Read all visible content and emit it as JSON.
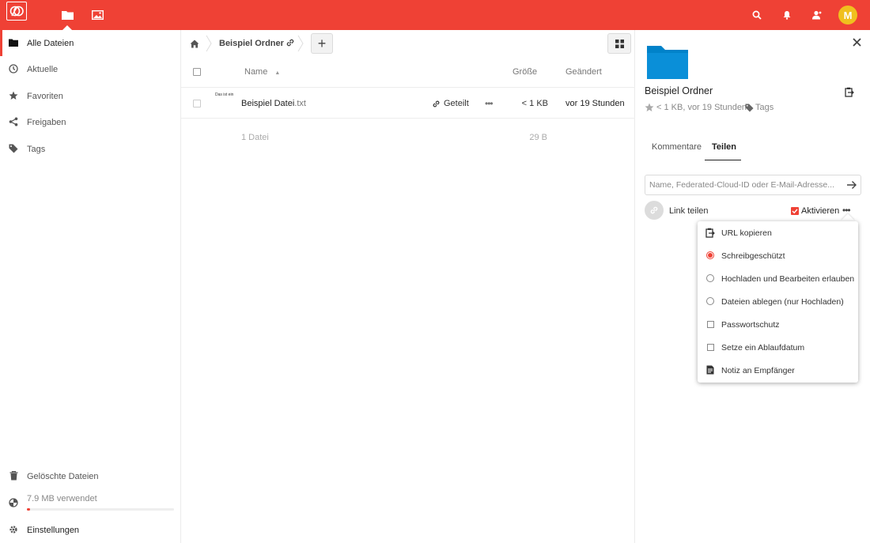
{
  "header": {
    "avatar_initial": "M",
    "brand_color": "#ef4135"
  },
  "sidebar": {
    "items": [
      {
        "label": "Alle Dateien",
        "icon": "folder-icon"
      },
      {
        "label": "Aktuelle",
        "icon": "clock-icon"
      },
      {
        "label": "Favoriten",
        "icon": "star-icon"
      },
      {
        "label": "Freigaben",
        "icon": "share-icon"
      },
      {
        "label": "Tags",
        "icon": "tag-icon"
      }
    ],
    "deleted_files": "Gelöschte Dateien",
    "quota_text": "7.9 MB verwendet",
    "quota_used_percent": 2,
    "settings": "Einstellungen"
  },
  "breadcrumb": {
    "folder": "Beispiel Ordner",
    "add_label": "+"
  },
  "file_table": {
    "columns": {
      "name": "Name",
      "size": "Größe",
      "modified": "Geändert"
    },
    "rows": [
      {
        "thumb_text": "Das ist ein",
        "name": "Beispiel Datei",
        "ext": ".txt",
        "shared_label": "Geteilt",
        "more": "•••",
        "size": "< 1 KB",
        "modified": "vor 19 Stunden"
      }
    ],
    "summary_count": "1 Datei",
    "summary_size": "29 B"
  },
  "details": {
    "title": "Beispiel Ordner",
    "meta": "< 1 KB, vor 19 Stunden",
    "tags_label": "Tags",
    "tabs": [
      "Kommentare",
      "Teilen"
    ],
    "share_input_placeholder": "Name, Federated-Cloud-ID oder E-Mail-Adresse...",
    "link_share_label": "Link teilen",
    "activate_label": "Aktivieren",
    "more": "•••"
  },
  "share_menu": {
    "items": [
      {
        "label": "URL kopieren",
        "control": "clipboard-icon"
      },
      {
        "label": "Schreibgeschützt",
        "control": "radio",
        "selected": true
      },
      {
        "label": "Hochladen und Bearbeiten erlauben",
        "control": "radio",
        "selected": false
      },
      {
        "label": "Dateien ablegen (nur Hochladen)",
        "control": "radio",
        "selected": false
      },
      {
        "label": "Passwortschutz",
        "control": "checkbox",
        "checked": false
      },
      {
        "label": "Setze ein Ablaufdatum",
        "control": "checkbox",
        "checked": false
      },
      {
        "label": "Notiz an Empfänger",
        "control": "note-icon"
      }
    ]
  }
}
